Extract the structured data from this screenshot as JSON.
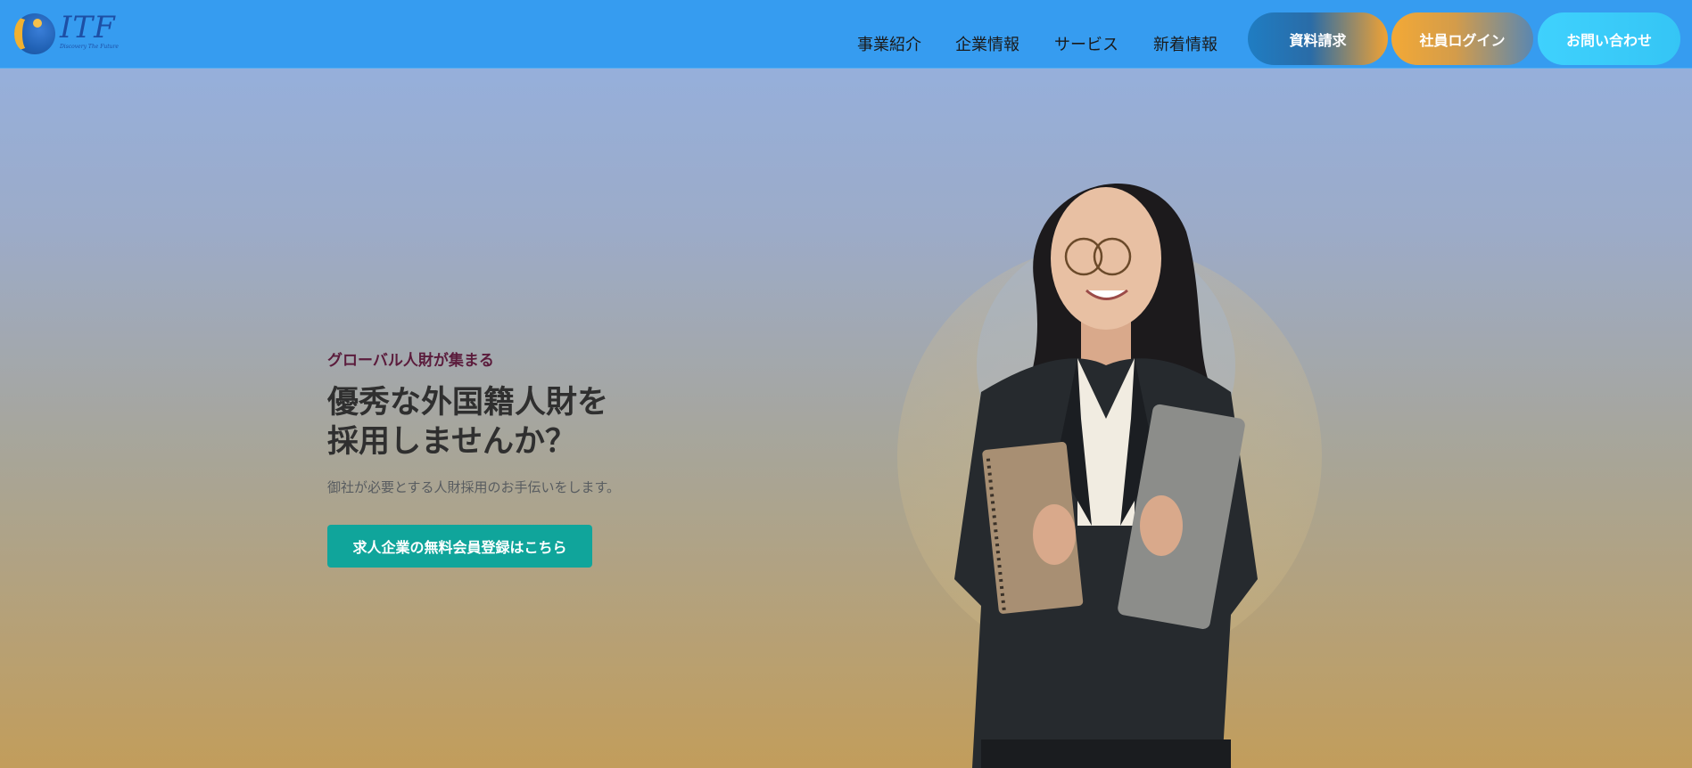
{
  "header": {
    "logo": {
      "text": "ITF",
      "tagline": "Discovery The Future",
      "icon": "globe-logo-icon"
    },
    "nav": [
      {
        "label": "事業紹介"
      },
      {
        "label": "企業情報"
      },
      {
        "label": "サービス"
      },
      {
        "label": "新着情報"
      }
    ],
    "buttons": {
      "docs": "資料請求",
      "login": "社員ログイン",
      "contact": "お問い合わせ"
    }
  },
  "hero": {
    "subtitle": "グローバル人財が集まる",
    "title_line1": "優秀な外国籍人財を",
    "title_line2": "採用しませんか？",
    "description": "御社が必要とする人財採用のお手伝いをします。",
    "cta": "求人企業の無料会員登録はこちら",
    "image": "businesswoman-holding-notebook-and-laptop"
  },
  "colors": {
    "header_bg": "#369cf0",
    "cta_bg": "#10a59b",
    "subtitle_color": "#5b1c3c",
    "accent_orange": "#f0a234",
    "accent_cyan": "#3fd1fd"
  }
}
